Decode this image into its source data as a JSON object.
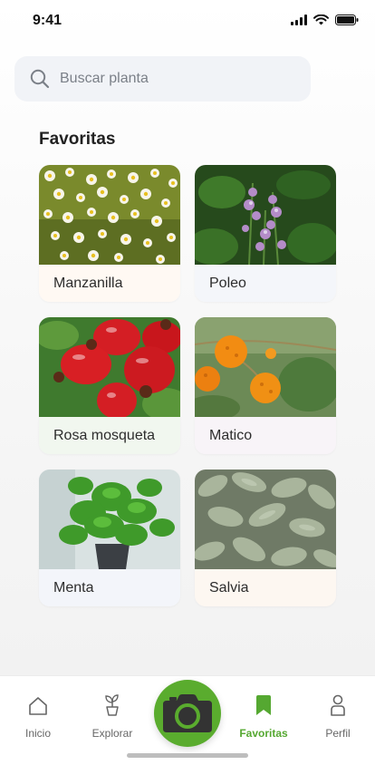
{
  "status_bar": {
    "time": "9:41"
  },
  "search": {
    "placeholder": "Buscar planta"
  },
  "section": {
    "title": "Favoritas"
  },
  "plants": [
    {
      "name": "Manzanilla",
      "tint": "#fff9f3"
    },
    {
      "name": "Poleo",
      "tint": "#f4f6fa"
    },
    {
      "name": "Rosa mosqueta",
      "tint": "#f1f7ef"
    },
    {
      "name": "Matico",
      "tint": "#f8f4f8"
    },
    {
      "name": "Menta",
      "tint": "#f3f5fa"
    },
    {
      "name": "Salvia",
      "tint": "#fdf7f1"
    }
  ],
  "nav": {
    "items": [
      {
        "label": "Inicio",
        "icon": "house-icon"
      },
      {
        "label": "Explorar",
        "icon": "plant-pot-icon"
      },
      {
        "label": "Favoritas",
        "icon": "bookmark-icon",
        "active": true
      },
      {
        "label": "Perfil",
        "icon": "person-icon"
      }
    ],
    "camera_icon": "camera-icon",
    "accent": "#5aac2e"
  }
}
